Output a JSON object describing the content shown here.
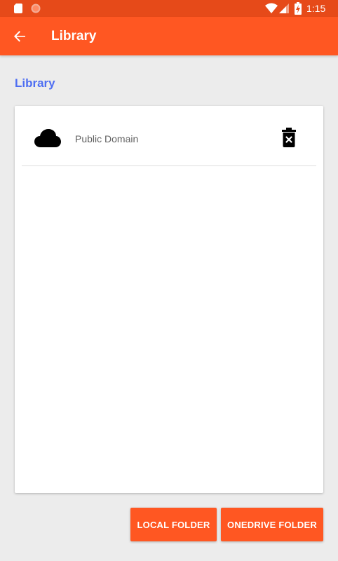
{
  "status_bar": {
    "time": "1:15",
    "icons": [
      "sd-card-icon",
      "record-icon",
      "wifi-icon",
      "signal-icon",
      "battery-charging-icon"
    ]
  },
  "app_bar": {
    "back_icon": "arrow-back-icon",
    "title": "Library"
  },
  "section": {
    "heading": "Library"
  },
  "libraries": [
    {
      "icon": "cloud-icon",
      "label": "Public Domain",
      "action_icon": "delete-icon"
    }
  ],
  "buttons": {
    "local_folder": "LOCAL FOLDER",
    "onedrive_folder": "ONEDRIVE FOLDER"
  },
  "colors": {
    "status_bar": "#e64a19",
    "app_bar": "#ff5722",
    "accent_text": "#4e6ef2",
    "background": "#ececec",
    "button": "#ff5722"
  }
}
